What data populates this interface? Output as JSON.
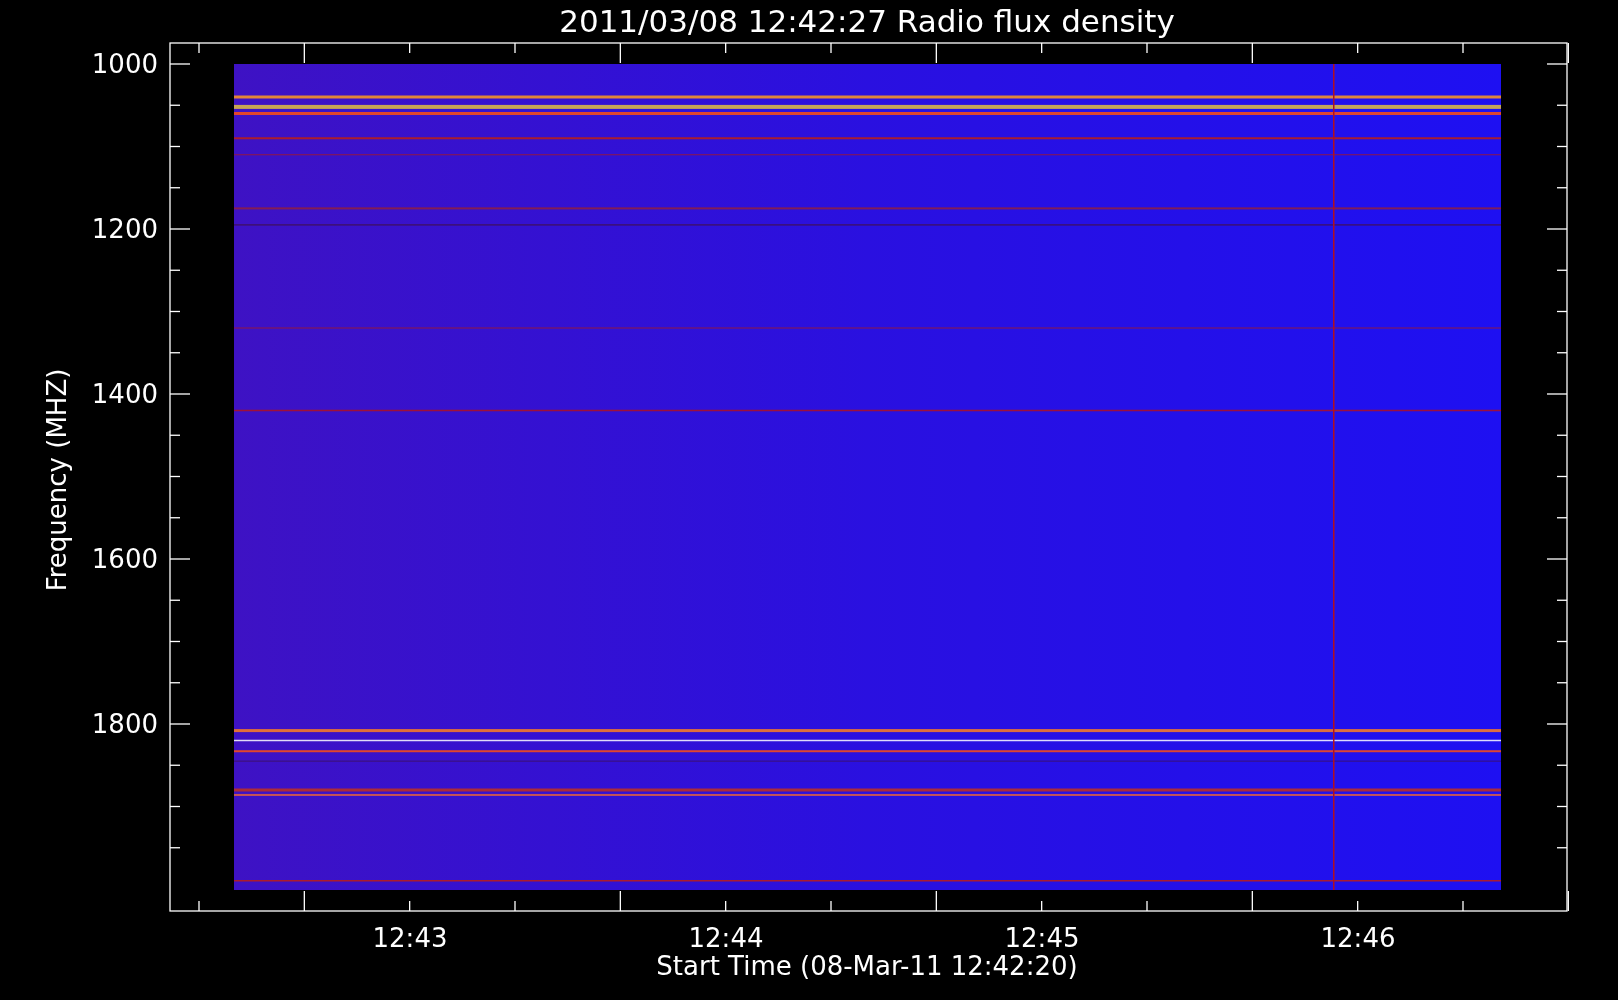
{
  "title": "2011/03/08 12:42:27 Radio flux density",
  "y_axis": {
    "label": "Frequency (MHZ)",
    "ticks": [
      "1000",
      "1200",
      "1400",
      "1600",
      "1800"
    ]
  },
  "x_axis": {
    "label": "Start Time (08-Mar-11 12:42:20)",
    "ticks": [
      "12:43",
      "12:44",
      "12:45",
      "12:46"
    ]
  }
}
